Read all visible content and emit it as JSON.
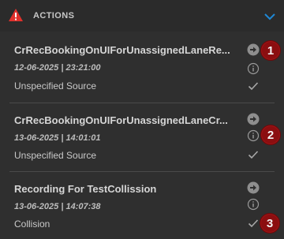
{
  "header": {
    "title": "ACTIONS",
    "warning_icon": "warning-triangle-icon",
    "toggle_icon": "chevron-down-icon"
  },
  "colors": {
    "warning": "#e0312c",
    "toggle": "#1e88d6",
    "badge": "#8b0e10",
    "background": "#2f2f2f"
  },
  "recordings": [
    {
      "name": "CrRecBookingOnUIForUnassignedLaneRe...",
      "date": "12-06-2025 | 23:21:00",
      "source": "Unspecified Source",
      "badge": "1"
    },
    {
      "name": "CrRecBookingOnUIForUnassignedLaneCr...",
      "date": "13-06-2025 | 14:01:01",
      "source": "Unspecified Source",
      "badge": "2"
    },
    {
      "name": "Recording For TestCollission",
      "date": "13-06-2025 | 14:07:38",
      "source": "Collision",
      "badge": "3"
    }
  ]
}
